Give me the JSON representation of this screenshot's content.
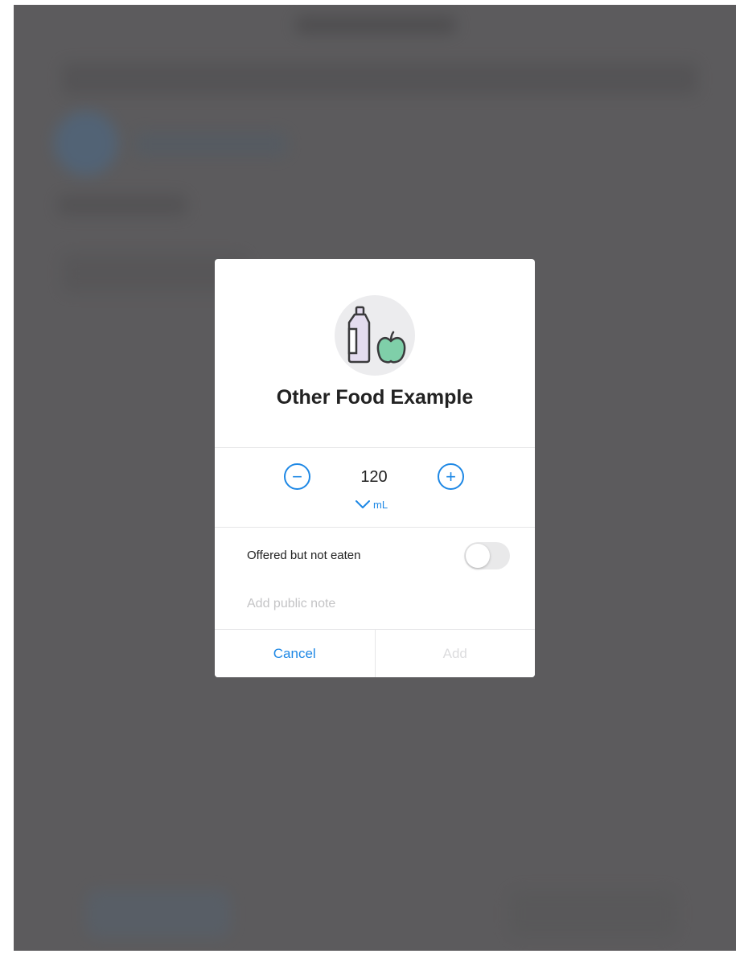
{
  "dialog": {
    "title": "Other Food Example",
    "food_icon": "bottle-and-apple-icon",
    "quantity": {
      "value": "120",
      "unit": "mL",
      "decrease_icon": "minus-circle-icon",
      "increase_icon": "plus-circle-icon",
      "unit_icon": "chevron-down-icon"
    },
    "offered_toggle": {
      "label": "Offered but not eaten",
      "on": false
    },
    "note": {
      "placeholder": "Add public note",
      "value": ""
    },
    "actions": {
      "cancel_label": "Cancel",
      "add_label": "Add",
      "add_enabled": false
    }
  },
  "colors": {
    "accent": "#1e88e5",
    "overlay": "#5c5b5d",
    "disabled": "#dcdcde",
    "apple": "#7fcfa9",
    "bottle": "#e4dcef"
  }
}
